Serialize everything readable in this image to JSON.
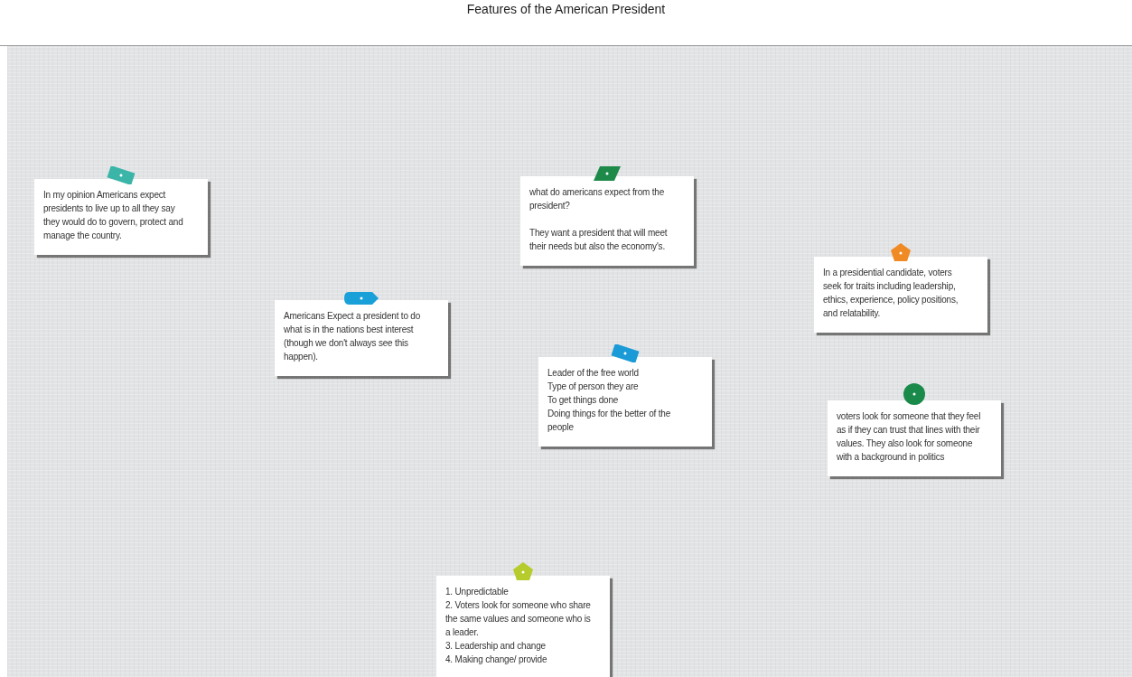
{
  "title": "Features of the American President",
  "notes": [
    {
      "text": "In my opinion Americans expect presidents to live up to all they say they would do to govern, protect and manage the country.",
      "pin": {
        "kind": "tape",
        "color": "#3ab5a8"
      }
    },
    {
      "text": "Americans Expect a president to do what is in the nations best interest (though we don't always see this happen).",
      "pin": {
        "kind": "tag",
        "color": "#1aa0d8"
      }
    },
    {
      "text": "what do americans expect from the president?\n\nThey want a president that will meet their needs but also the economy's.",
      "pin": {
        "kind": "parallelogram",
        "color": "#1e8a4a"
      }
    },
    {
      "text": "Leader of the free world\nType of person they are\nTo get things done\nDoing things for the better of the people",
      "pin": {
        "kind": "tape",
        "color": "#1a9ad6"
      }
    },
    {
      "text": "In a presidential candidate, voters seek for traits including leadership, ethics, experience, policy positions, and relatability.",
      "pin": {
        "kind": "pentagon",
        "color": "#f08a24"
      }
    },
    {
      "text": "voters look for someone that they feel as if they can trust that lines with their values. They also look for someone with a background in politics",
      "pin": {
        "kind": "circle",
        "color": "#1a8a4a"
      }
    },
    {
      "text": "1. Unpredictable\n2. Voters look for someone who share the same values and someone who is a leader.\n3. Leadership and change\n4. Making change/ provide",
      "pin": {
        "kind": "pentagon",
        "color": "#b5cc2c"
      }
    }
  ]
}
